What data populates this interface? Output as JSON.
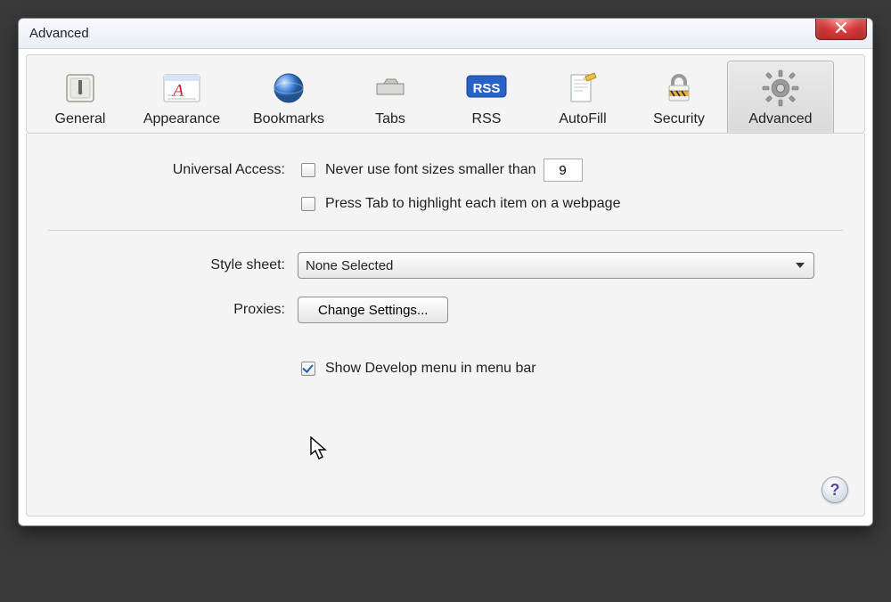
{
  "window": {
    "title": "Advanced"
  },
  "toolbar": {
    "items": [
      {
        "id": "general",
        "label": "General"
      },
      {
        "id": "appearance",
        "label": "Appearance"
      },
      {
        "id": "bookmarks",
        "label": "Bookmarks"
      },
      {
        "id": "tabs",
        "label": "Tabs"
      },
      {
        "id": "rss",
        "label": "RSS"
      },
      {
        "id": "autofill",
        "label": "AutoFill"
      },
      {
        "id": "security",
        "label": "Security"
      },
      {
        "id": "advanced",
        "label": "Advanced"
      }
    ],
    "active": "advanced"
  },
  "advanced": {
    "universal_access_label": "Universal Access:",
    "min_font_checkbox_label": "Never use font sizes smaller than",
    "min_font_value": "9",
    "press_tab_label": "Press Tab to highlight each item on a webpage",
    "style_sheet_label": "Style sheet:",
    "style_sheet_value": "None Selected",
    "proxies_label": "Proxies:",
    "change_settings_label": "Change Settings...",
    "show_develop_label": "Show Develop menu in menu bar",
    "show_develop_checked": true
  },
  "help_label": "?"
}
